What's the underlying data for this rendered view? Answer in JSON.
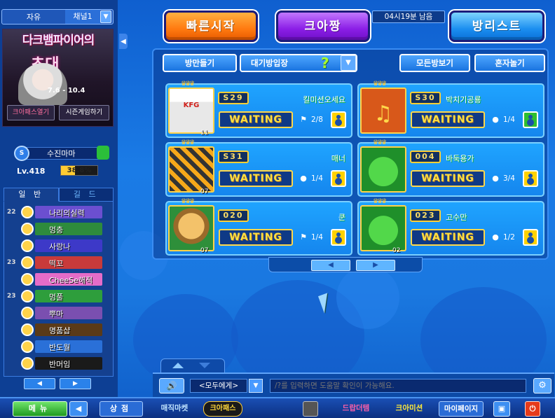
{
  "channel": {
    "free": "자유",
    "channel": "채널1",
    "dropdown_glyph": "▼"
  },
  "banner": {
    "title": "다크뱀파이어의",
    "subtitle": "초대",
    "date": "7.6 - 10.4",
    "btn_pass": "크아패스열기",
    "btn_season": "시즌게임하기"
  },
  "profile": {
    "name": "수진마마",
    "level_label": "Lv.418",
    "exp_text": "38.8%",
    "exp_fraction": 0.388
  },
  "friend_tabs": {
    "general": "일 반",
    "guild": "길 드"
  },
  "friends": [
    {
      "level": "22",
      "name": "나리의실력",
      "color": "#6b4fd0"
    },
    {
      "level": "",
      "name": "멍충",
      "color": "#2e8b3c"
    },
    {
      "level": "",
      "name": "사랑나",
      "color": "#3d39c8"
    },
    {
      "level": "23",
      "name": "떡꼬",
      "color": "#c83a3a"
    },
    {
      "level": "",
      "name": "CheeSe해적",
      "color": "#e56cc8"
    },
    {
      "level": "23",
      "name": "멍풀",
      "color": "#2e9e3c"
    },
    {
      "level": "",
      "name": "뿌마",
      "color": "#7a4fb0"
    },
    {
      "level": "",
      "name": "명품샵",
      "color": "#5a3a18"
    },
    {
      "level": "",
      "name": "반도월",
      "color": "#2a70d8"
    },
    {
      "level": "",
      "name": "반머임",
      "color": "#1a1a1a"
    }
  ],
  "pager": {
    "prev": "◀",
    "next": "▶"
  },
  "top": {
    "quick": "빠른시작",
    "krang": "크아짱",
    "time_left": "04시19분 남음",
    "roomlist": "방리스트"
  },
  "tools": {
    "make": "방만들기",
    "wait": "대기방입장",
    "wait_q": "?",
    "all": "모든방보기",
    "solo": "혼자놀기"
  },
  "rooms": [
    {
      "num": "S29",
      "title": "킬미션오세요",
      "status": "WAITING",
      "count": "2/8",
      "mode": "flag",
      "join": "yellow",
      "thumb": "kfg",
      "thumb_label": "KFG",
      "corner": "11"
    },
    {
      "num": "S30",
      "title": "박치기공룡",
      "status": "WAITING",
      "count": "1/4",
      "mode": "ghost",
      "join": "green",
      "thumb": "music",
      "thumb_label": "♫",
      "corner": ""
    },
    {
      "num": "S31",
      "title": "매너",
      "status": "WAITING",
      "count": "1/4",
      "mode": "ghost",
      "join": "yellow",
      "thumb": "tank",
      "thumb_label": "",
      "corner": "07"
    },
    {
      "num": "004",
      "title": "바둑용가",
      "status": "WAITING",
      "count": "3/4",
      "mode": "ghost",
      "join": "yellow",
      "thumb": "blob",
      "thumb_label": "",
      "corner": ""
    },
    {
      "num": "020",
      "title": "쿤",
      "status": "WAITING",
      "count": "1/4",
      "mode": "flag",
      "join": "yellow",
      "thumb": "stump",
      "thumb_label": "",
      "corner": "07"
    },
    {
      "num": "023",
      "title": "고수만",
      "status": "WAITING",
      "count": "1/2",
      "mode": "ghost",
      "join": "yellow",
      "thumb": "blob",
      "thumb_label": "",
      "corner": "02"
    }
  ],
  "room_pager": {
    "prev": "◀",
    "next": "▶"
  },
  "chat": {
    "speaker": "🔊",
    "target": "<모두에게>",
    "target_drop": "▼",
    "placeholder": "/?를 입력하면 도움말 확인이 가능해요.",
    "settings": "⚙"
  },
  "bottom": {
    "menu": "메뉴",
    "back": "◀",
    "shop": "상점",
    "magic": "매직마켓",
    "krapass": "크아패스",
    "drop": "드랍더템",
    "mission": "크아미션",
    "mypage": "마이페이지",
    "save": "▣",
    "power": "⏻"
  }
}
